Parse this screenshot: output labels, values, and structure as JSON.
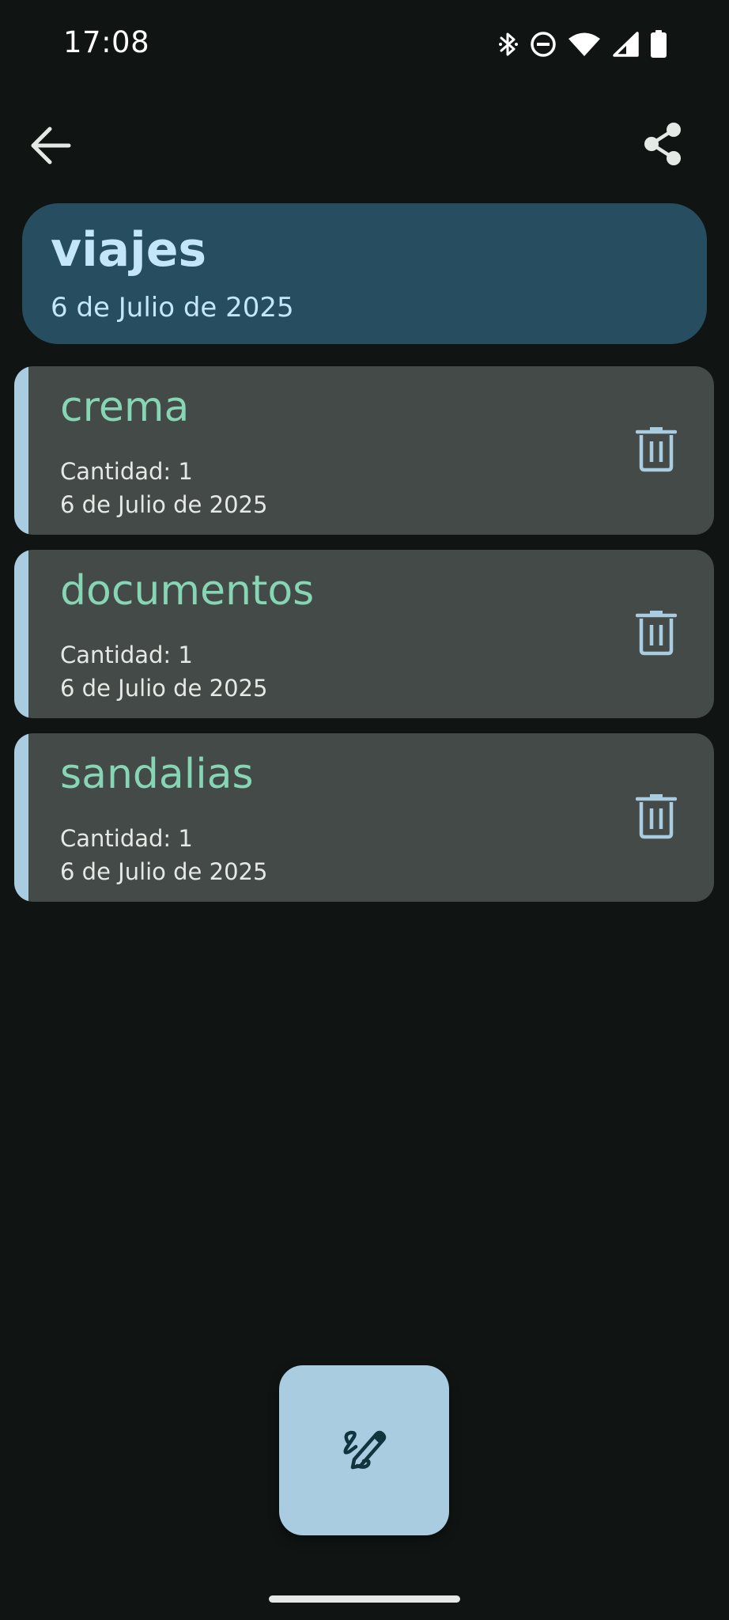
{
  "status_bar": {
    "time": "17:08",
    "icons": [
      "bluetooth-icon",
      "do-not-disturb-icon",
      "wifi-icon",
      "signal-icon",
      "battery-icon"
    ]
  },
  "app_bar": {
    "back_icon": "arrow-back-icon",
    "share_icon": "share-icon"
  },
  "header": {
    "title": "viajes",
    "date": "6 de Julio de 2025"
  },
  "items": [
    {
      "name": "crema",
      "quantity": "Cantidad: 1",
      "date": "6 de Julio de 2025",
      "action_icon": "delete-icon"
    },
    {
      "name": "documentos",
      "quantity": "Cantidad: 1",
      "date": "6 de Julio de 2025",
      "action_icon": "delete-icon"
    },
    {
      "name": "sandalias",
      "quantity": "Cantidad: 1",
      "date": "6 de Julio de 2025",
      "action_icon": "delete-icon"
    }
  ],
  "fab": {
    "icon": "draw-edit-icon"
  },
  "colors": {
    "background": "#101514",
    "header_card": "#274d61",
    "header_text": "#c4e6fb",
    "item_card": "#434a47",
    "item_accent": "#a9cce0",
    "item_name": "#86d5b4",
    "item_text": "#e4e9e6",
    "fab": "#a9cce0"
  }
}
